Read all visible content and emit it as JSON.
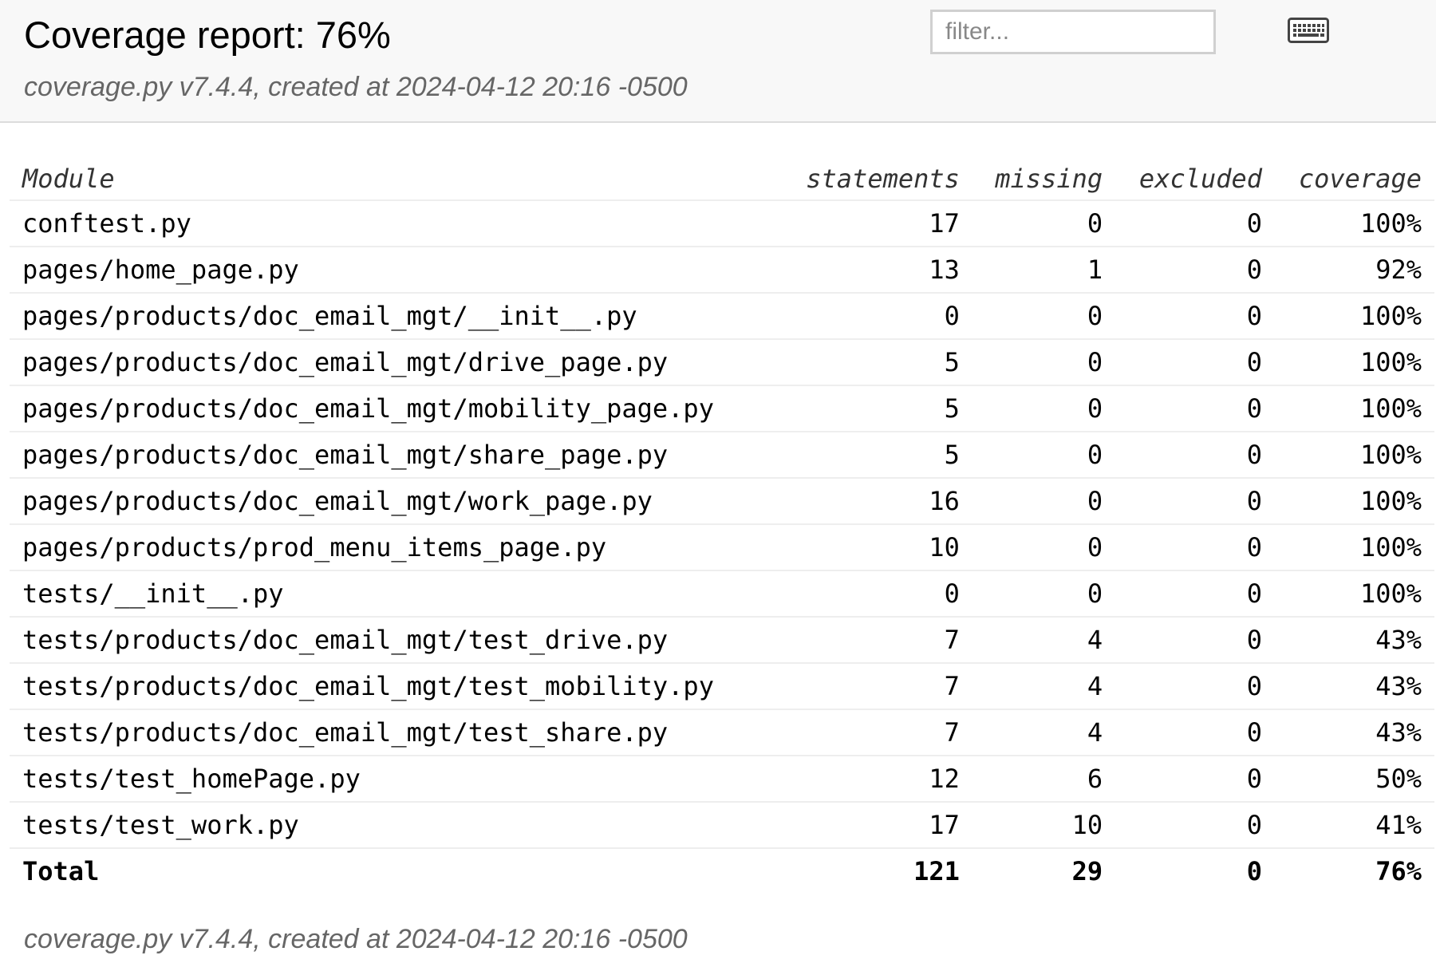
{
  "header": {
    "title": "Coverage report: 76%",
    "subtitle": "coverage.py v7.4.4, created at 2024-04-12 20:16 -0500",
    "filter_placeholder": "filter...",
    "keyboard_icon": "keyboard-icon"
  },
  "table": {
    "columns": {
      "module": "Module",
      "statements": "statements",
      "missing": "missing",
      "excluded": "excluded",
      "coverage": "coverage"
    },
    "rows": [
      {
        "module": "conftest.py",
        "statements": "17",
        "missing": "0",
        "excluded": "0",
        "coverage": "100%"
      },
      {
        "module": "pages/home_page.py",
        "statements": "13",
        "missing": "1",
        "excluded": "0",
        "coverage": "92%"
      },
      {
        "module": "pages/products/doc_email_mgt/__init__.py",
        "statements": "0",
        "missing": "0",
        "excluded": "0",
        "coverage": "100%"
      },
      {
        "module": "pages/products/doc_email_mgt/drive_page.py",
        "statements": "5",
        "missing": "0",
        "excluded": "0",
        "coverage": "100%"
      },
      {
        "module": "pages/products/doc_email_mgt/mobility_page.py",
        "statements": "5",
        "missing": "0",
        "excluded": "0",
        "coverage": "100%"
      },
      {
        "module": "pages/products/doc_email_mgt/share_page.py",
        "statements": "5",
        "missing": "0",
        "excluded": "0",
        "coverage": "100%"
      },
      {
        "module": "pages/products/doc_email_mgt/work_page.py",
        "statements": "16",
        "missing": "0",
        "excluded": "0",
        "coverage": "100%"
      },
      {
        "module": "pages/products/prod_menu_items_page.py",
        "statements": "10",
        "missing": "0",
        "excluded": "0",
        "coverage": "100%"
      },
      {
        "module": "tests/__init__.py",
        "statements": "0",
        "missing": "0",
        "excluded": "0",
        "coverage": "100%"
      },
      {
        "module": "tests/products/doc_email_mgt/test_drive.py",
        "statements": "7",
        "missing": "4",
        "excluded": "0",
        "coverage": "43%"
      },
      {
        "module": "tests/products/doc_email_mgt/test_mobility.py",
        "statements": "7",
        "missing": "4",
        "excluded": "0",
        "coverage": "43%"
      },
      {
        "module": "tests/products/doc_email_mgt/test_share.py",
        "statements": "7",
        "missing": "4",
        "excluded": "0",
        "coverage": "43%"
      },
      {
        "module": "tests/test_homePage.py",
        "statements": "12",
        "missing": "6",
        "excluded": "0",
        "coverage": "50%"
      },
      {
        "module": "tests/test_work.py",
        "statements": "17",
        "missing": "10",
        "excluded": "0",
        "coverage": "41%"
      }
    ],
    "total": {
      "module": "Total",
      "statements": "121",
      "missing": "29",
      "excluded": "0",
      "coverage": "76%"
    }
  },
  "footer": {
    "text": "coverage.py v7.4.4, created at 2024-04-12 20:16 -0500"
  }
}
